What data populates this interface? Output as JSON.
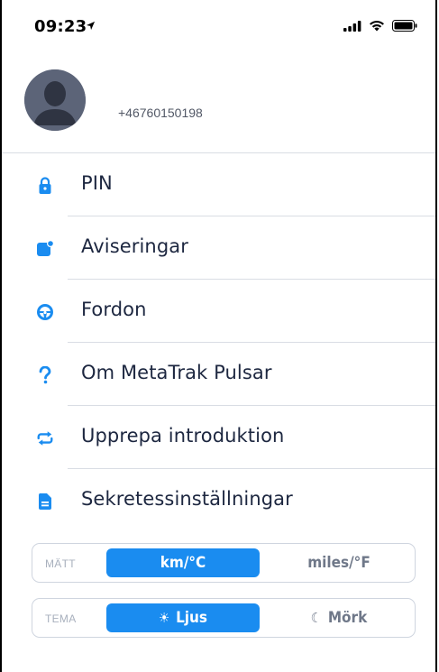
{
  "status": {
    "time": "09:23"
  },
  "profile": {
    "phone": "+46760150198"
  },
  "menu": {
    "items": [
      {
        "label": "PIN",
        "icon": "lock-icon"
      },
      {
        "label": "Aviseringar",
        "icon": "notification-icon"
      },
      {
        "label": "Fordon",
        "icon": "steering-wheel-icon"
      },
      {
        "label": "Om MetaTrak Pulsar",
        "icon": "question-icon"
      },
      {
        "label": "Upprepa introduktion",
        "icon": "repeat-icon"
      },
      {
        "label": "Sekretessinställningar",
        "icon": "document-icon"
      }
    ]
  },
  "units": {
    "title": "MÄTT",
    "options": [
      "km/°C",
      "miles/°F"
    ],
    "selected": "km/°C"
  },
  "theme": {
    "title": "TEMA",
    "light": {
      "label": "Ljus",
      "icon": "sun-icon"
    },
    "dark": {
      "label": "Mörk",
      "icon": "moon-icon"
    },
    "selected": "Ljus"
  },
  "colors": {
    "accent": "#1a8cf0",
    "text": "#1d2740",
    "muted": "#a8b0bd",
    "divider": "#d9dde4"
  }
}
